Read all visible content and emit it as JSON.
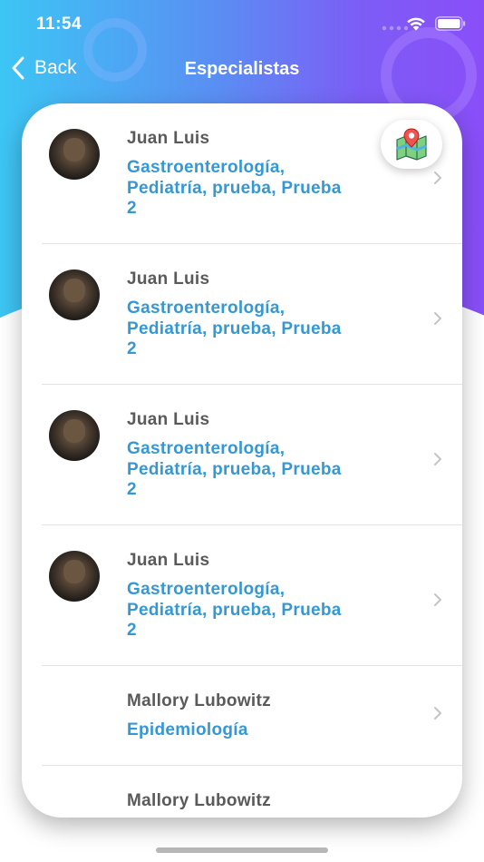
{
  "status_bar": {
    "time": "11:54"
  },
  "nav": {
    "back_label": "Back",
    "title": "Especialistas"
  },
  "specialists": [
    {
      "name": "Juan Luis",
      "specialties": "Gastroenterología, Pediatría, prueba, Prueba 2",
      "has_avatar": true
    },
    {
      "name": "Juan Luis",
      "specialties": "Gastroenterología, Pediatría, prueba, Prueba 2",
      "has_avatar": true
    },
    {
      "name": "Juan Luis",
      "specialties": "Gastroenterología, Pediatría, prueba, Prueba 2",
      "has_avatar": true
    },
    {
      "name": "Juan Luis",
      "specialties": "Gastroenterología, Pediatría, prueba, Prueba 2",
      "has_avatar": true
    },
    {
      "name": "Mallory Lubowitz",
      "specialties": "Epidemiología",
      "has_avatar": false
    },
    {
      "name": "Mallory Lubowitz",
      "specialties": "",
      "has_avatar": false
    }
  ],
  "icons": {
    "back": "chevron-left-icon",
    "row_arrow": "chevron-right-icon",
    "map": "map-icon",
    "wifi": "wifi-icon",
    "battery": "battery-icon"
  },
  "colors": {
    "gradient_start": "#3cc6f4",
    "gradient_end": "#8a4ef8",
    "name_text": "#5a5a5a",
    "specialty_text": "#3598d4"
  }
}
